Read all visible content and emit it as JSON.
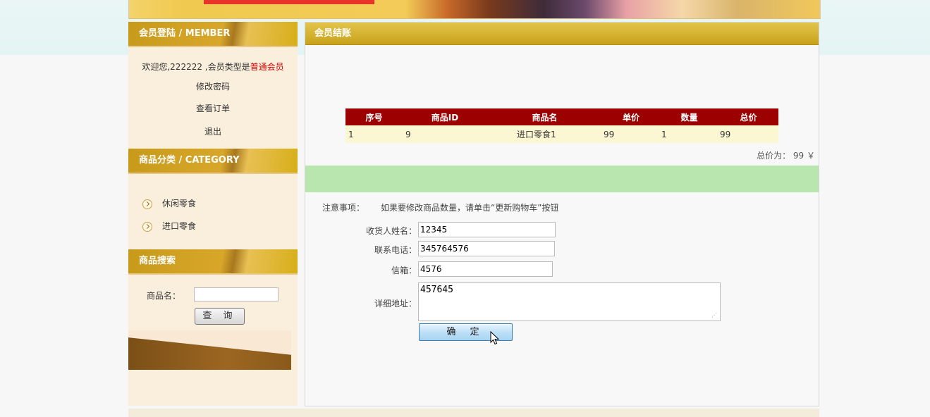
{
  "sidebar": {
    "member": {
      "title": "会员登陆 / MEMBER",
      "welcome_prefix": "欢迎您,222222 ,会员类型是",
      "member_type": "普通会员",
      "links": [
        "修改密码",
        "查看订单",
        "退出"
      ]
    },
    "category": {
      "title": "商品分类 / CATEGORY",
      "items": [
        "休闲零食",
        "进口零食"
      ]
    },
    "search": {
      "title": "商品搜索",
      "label": "商品名：",
      "button": "查 询"
    }
  },
  "main": {
    "title": "会员结账",
    "table": {
      "headers": [
        "序号",
        "商品ID",
        "商品名",
        "单价",
        "数量",
        "总价"
      ],
      "rows": [
        [
          "1",
          "9",
          "进口零食1",
          "99",
          "1",
          "99"
        ]
      ]
    },
    "total_text": "总价为： 99 ￥",
    "notice_label": "注意事项：",
    "notice_text": "如果要修改商品数量，请单击“更新购物车”按钮",
    "form": {
      "name_label": "收货人姓名：",
      "name_value": "12345",
      "phone_label": "联系电话：",
      "phone_value": "345764576",
      "email_label": "信箱：",
      "email_value": "4576",
      "address_label": "详细地址：",
      "address_value": "457645",
      "submit": "确 定"
    }
  },
  "colors": {
    "header_gold": "#d7ae18",
    "table_header": "#9c0000",
    "highlight_red": "#d80000",
    "notice_band": "#b9e6af"
  }
}
